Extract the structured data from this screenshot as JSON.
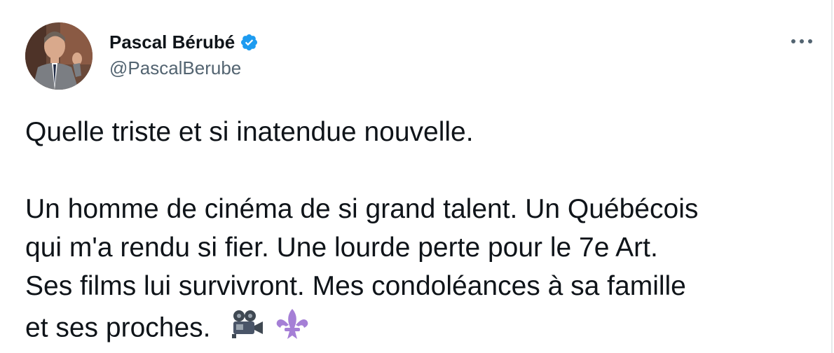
{
  "tweet": {
    "author": {
      "display_name": "Pascal Bérubé",
      "handle": "@PascalBerube",
      "verified": true
    },
    "more_icon": "more-horizontal-icon",
    "lines": [
      "Quelle triste et si inatendue nouvelle.",
      "Un homme de cinéma de si grand talent. Un Québécois",
      "qui m'a rendu si fier. Une lourde perte pour le 7e Art.",
      "Ses films lui survivront. Mes condoléances à sa famille",
      "et ses proches."
    ],
    "emojis": [
      "movie-camera-emoji",
      "fleur-de-lis-emoji"
    ]
  },
  "colors": {
    "text": "#0f1419",
    "secondary": "#536471",
    "verified_badge": "#1d9bf0",
    "fleur_de_lis": "#a57fd6",
    "camera": "#4a5568"
  }
}
